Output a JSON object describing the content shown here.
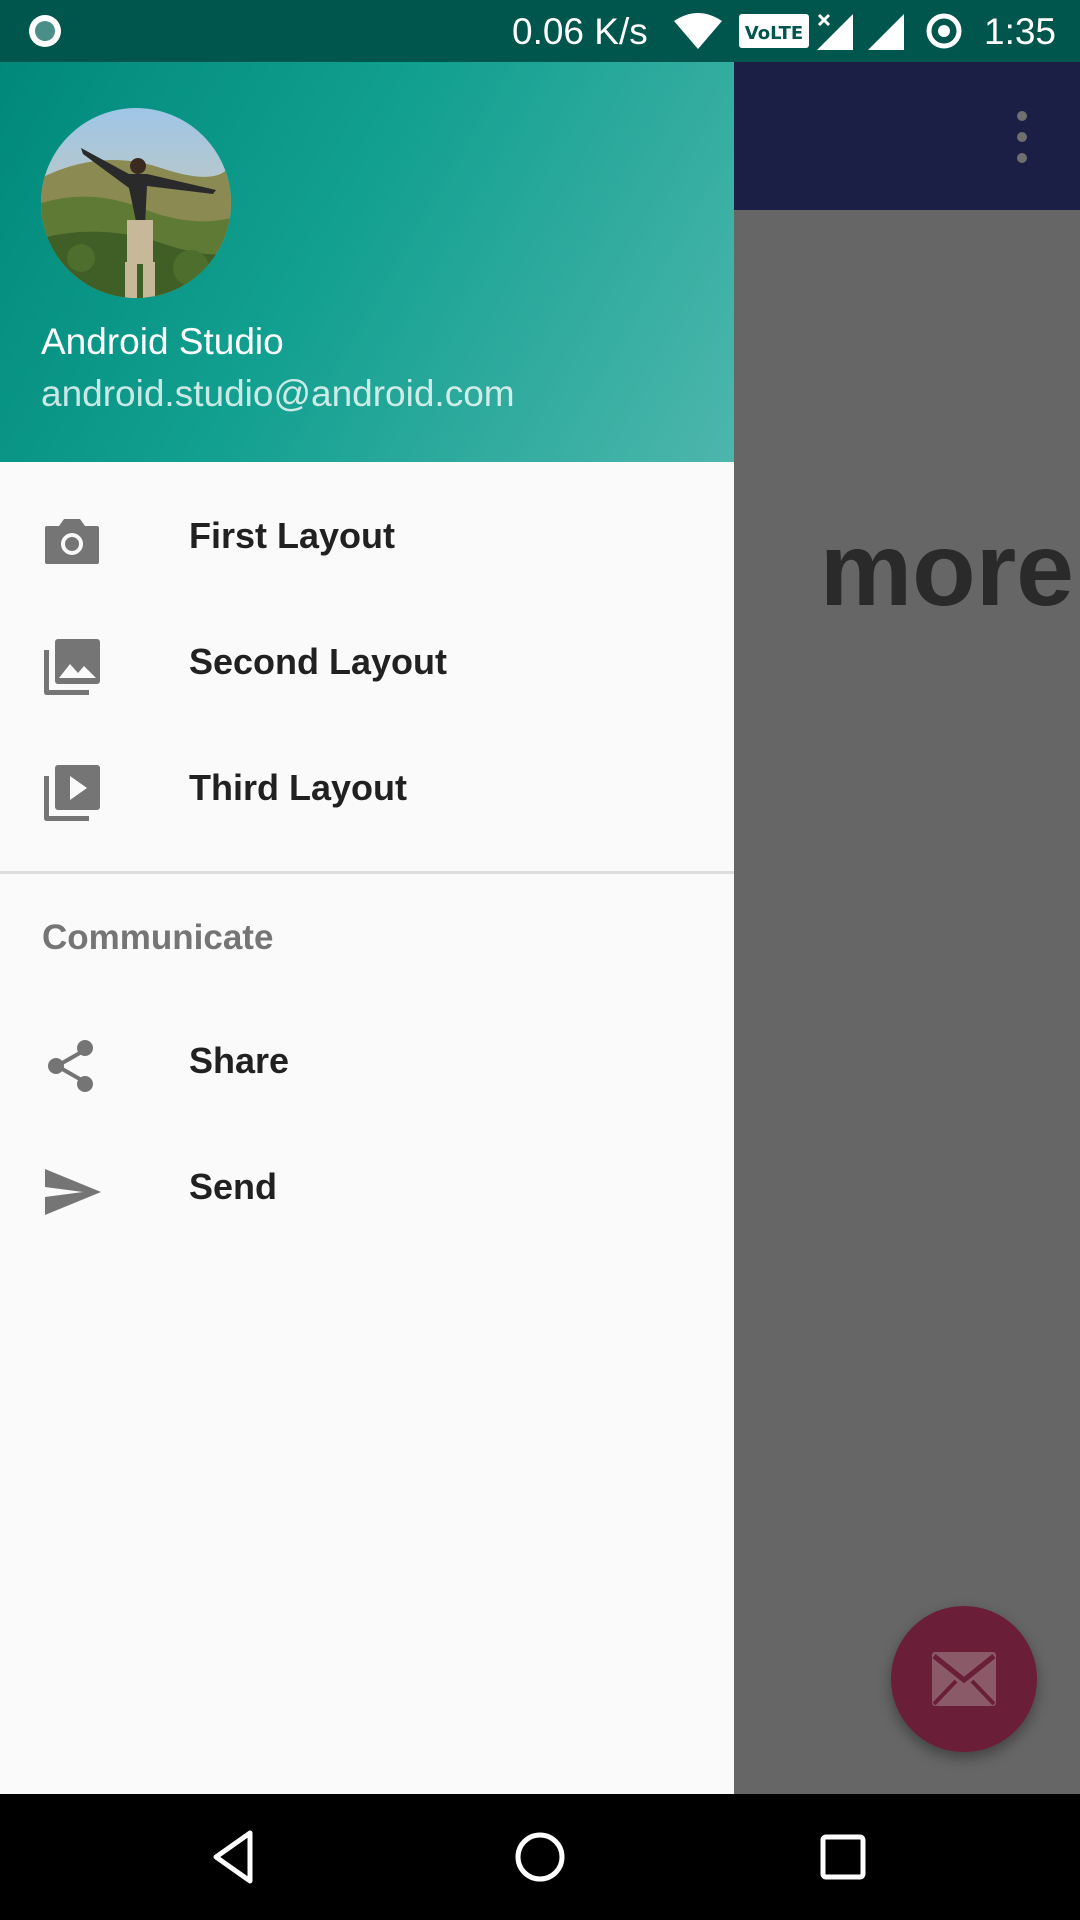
{
  "status_bar": {
    "net_speed": "0.06 K/s",
    "volte_label": "VoLTE",
    "time": "1:35",
    "icons": [
      "app-notification-icon",
      "wifi-icon",
      "volte-icon",
      "signal-roaming-icon",
      "signal-icon",
      "data-saver-icon"
    ]
  },
  "toolbar": {
    "overflow_icon": "more-vert-icon"
  },
  "background_content": {
    "partial_text": "more"
  },
  "fab": {
    "icon": "mail-icon",
    "color": "#6a1e38"
  },
  "drawer": {
    "header": {
      "name": "Android Studio",
      "email": "android.studio@android.com",
      "gradient_colors": [
        "#00897b",
        "#4db6ac"
      ]
    },
    "items": [
      {
        "label": "First Layout",
        "icon": "camera-icon"
      },
      {
        "label": "Second Layout",
        "icon": "gallery-icon"
      },
      {
        "label": "Third Layout",
        "icon": "slideshow-icon"
      }
    ],
    "section": {
      "title": "Communicate",
      "items": [
        {
          "label": "Share",
          "icon": "share-icon"
        },
        {
          "label": "Send",
          "icon": "send-icon"
        }
      ]
    }
  },
  "nav_bar": {
    "buttons": [
      "back-icon",
      "home-icon",
      "recents-icon"
    ]
  },
  "colors": {
    "status_bar": "#00564d",
    "toolbar": "#1b1e45",
    "scrim_content": "#666666",
    "drawer_background": "#fafafa",
    "menu_text": "#212121",
    "section_title": "#757575",
    "icon": "#757575"
  }
}
